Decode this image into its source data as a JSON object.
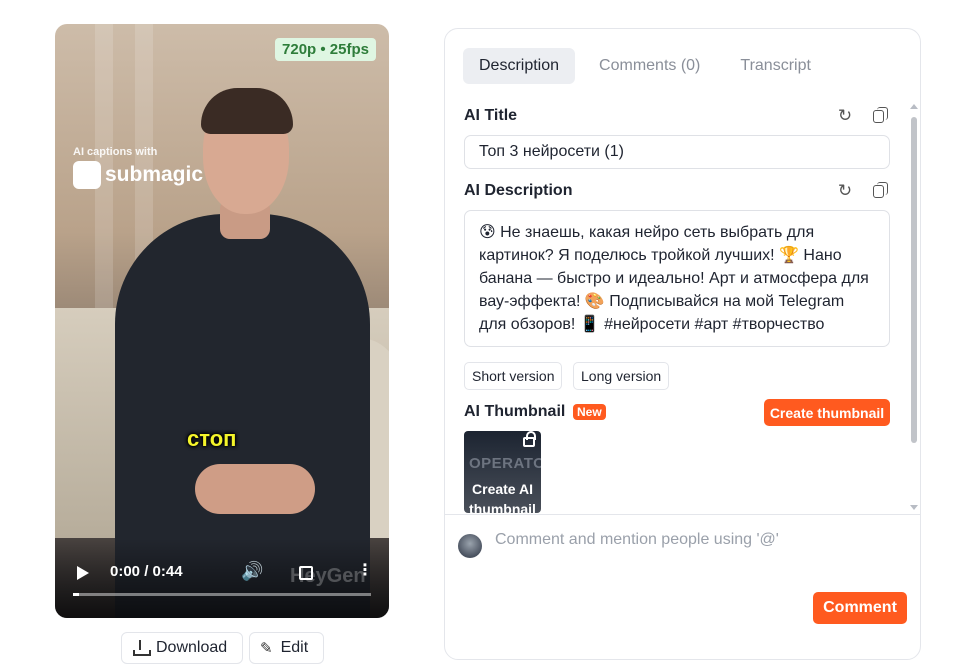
{
  "video": {
    "quality_badge": "720p • 25fps",
    "promo_small": "AI captions with",
    "promo_brand": "submagic",
    "subtitle": "стоп",
    "time": "0:00 / 0:44",
    "watermark": "HeyGen",
    "progress_fraction": 0.02
  },
  "actions": {
    "download_label": "Download",
    "edit_label": "Edit"
  },
  "tabs": [
    {
      "label": "Description",
      "active": true
    },
    {
      "label": "Comments (0)",
      "active": false
    },
    {
      "label": "Transcript",
      "active": false
    }
  ],
  "ai_title": {
    "label": "AI Title",
    "value": "Топ 3 нейросети (1)"
  },
  "ai_description": {
    "label": "AI Description",
    "value": "😰 Не знаешь, какая нейро сеть выбрать для картинок? Я поделюсь тройкой лучших! 🏆 Нано банана — быстро и идеально! Арт и атмосфера для вау-эффекта! 🎨 Подписывайся на мой Telegram для обзоров! 📱 #нейросети #арт #творчество"
  },
  "version_buttons": {
    "short": "Short version",
    "long": "Long version"
  },
  "ai_thumbnail": {
    "label": "AI Thumbnail",
    "new_badge": "New",
    "create_button": "Create thumbnail",
    "thumb_title": "OPERATOR",
    "thumb_cta": "Create AI thumbnail"
  },
  "comment": {
    "placeholder": "Comment and mention people using '@'",
    "submit_label": "Comment"
  },
  "colors": {
    "accent": "#ff5a1f",
    "quality_badge_bg": "#dff6e2",
    "subtitle": "#f5f52a"
  }
}
